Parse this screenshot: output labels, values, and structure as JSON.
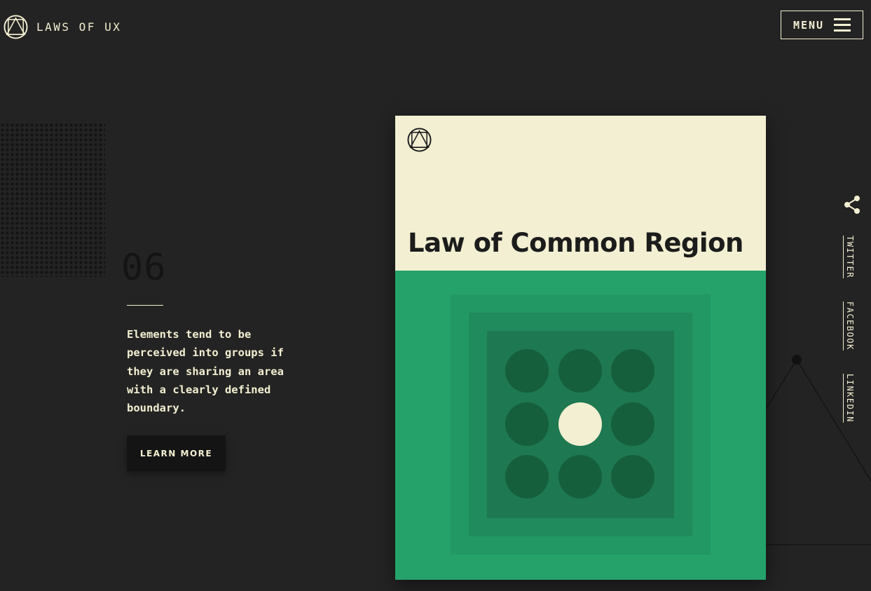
{
  "header": {
    "brand": "LAWS OF UX",
    "menu_label": "MENU"
  },
  "law": {
    "number": "06",
    "description": "Elements tend to be perceived into groups if they are sharing an area with a clearly defined boundary.",
    "cta_label": "LEARN MORE",
    "title": "Law of Common Region"
  },
  "social": {
    "links": [
      "TWITTER",
      "FACEBOOK",
      "LINKEDIN"
    ]
  },
  "colors": {
    "background": "#232323",
    "cream": "#f3efd2",
    "green": "#25a26a",
    "dark_green": "#155f3c"
  },
  "icons": [
    "logo-icon",
    "hamburger-icon",
    "share-icon"
  ]
}
